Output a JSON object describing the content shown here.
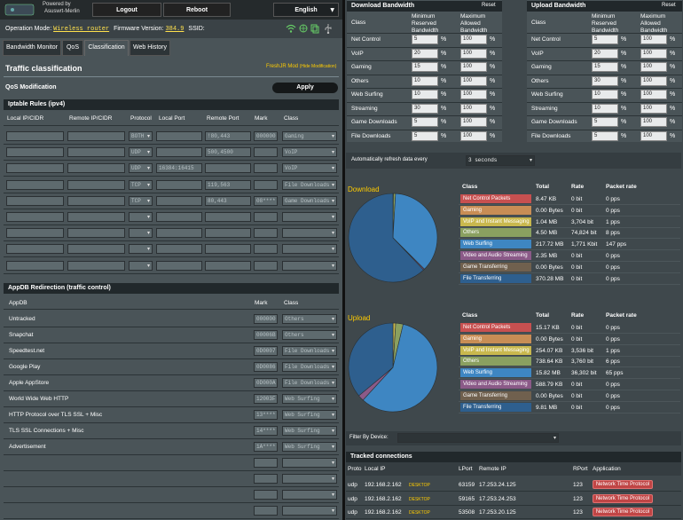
{
  "topbar": {
    "powered_by": "Powered by",
    "brand": "Asuswrt-Merlin",
    "logout": "Logout",
    "reboot": "Reboot",
    "language": "English"
  },
  "status": {
    "mode_label": "Operation Mode:",
    "mode_value": "Wireless router",
    "fw_label": "Firmware Version:",
    "fw_value": "384.9",
    "ssid_label": "SSID:"
  },
  "tabs": [
    "Bandwidth Monitor",
    "QoS",
    "Classification",
    "Web History"
  ],
  "page": {
    "title": "Traffic classification",
    "mod": "FreshJR Mod",
    "mod_hide": "(Hide Modification)",
    "qos_mod": "QoS Modification",
    "apply": "Apply"
  },
  "iptable": {
    "title": "Iptable Rules (ipv4)",
    "headers": [
      "Local IP/CIDR",
      "Remote IP/CIDR",
      "Protocol",
      "Local Port",
      "Remote Port",
      "Mark",
      "Class"
    ],
    "rows": [
      {
        "proto": "BOTH",
        "lport": "",
        "rport": "!80,443",
        "mark": "000000",
        "cls": "Gaming"
      },
      {
        "proto": "UDP",
        "lport": "",
        "rport": "500,4500",
        "mark": "",
        "cls": "VoIP"
      },
      {
        "proto": "UDP",
        "lport": "16384:16415",
        "rport": "",
        "mark": "",
        "cls": "VoIP"
      },
      {
        "proto": "TCP",
        "lport": "",
        "rport": "119,563",
        "mark": "",
        "cls": "File Downloads"
      },
      {
        "proto": "TCP",
        "lport": "",
        "rport": "80,443",
        "mark": "08****",
        "cls": "Game Downloads"
      },
      {
        "proto": "",
        "lport": "",
        "rport": "",
        "mark": "",
        "cls": ""
      },
      {
        "proto": "",
        "lport": "",
        "rport": "",
        "mark": "",
        "cls": ""
      },
      {
        "proto": "",
        "lport": "",
        "rport": "",
        "mark": "",
        "cls": ""
      },
      {
        "proto": "",
        "lport": "",
        "rport": "",
        "mark": "",
        "cls": ""
      }
    ]
  },
  "appdb": {
    "title": "AppDB Redirection (traffic control)",
    "headers": [
      "AppDB",
      "Mark",
      "Class"
    ],
    "rows": [
      {
        "name": "Untracked",
        "mark": "000000",
        "cls": "Others"
      },
      {
        "name": "Snapchat",
        "mark": "00006B",
        "cls": "Others"
      },
      {
        "name": "Speedtest.net",
        "mark": "0D0007",
        "cls": "File Downloads"
      },
      {
        "name": "Google Play",
        "mark": "0D0086",
        "cls": "File Downloads"
      },
      {
        "name": "Apple AppStore",
        "mark": "0D000A",
        "cls": "File Downloads"
      },
      {
        "name": "World Wide Web HTTP",
        "mark": "12003F",
        "cls": "Web Surfing"
      },
      {
        "name": "HTTP Protocol over TLS SSL + Misc",
        "mark": "13****",
        "cls": "Web Surfing"
      },
      {
        "name": "TLS SSL Connections + Misc",
        "mark": "14****",
        "cls": "Web Surfing"
      },
      {
        "name": "Advertisement",
        "mark": "1A****",
        "cls": "Web Surfing"
      },
      {
        "name": "",
        "mark": "",
        "cls": ""
      },
      {
        "name": "",
        "mark": "",
        "cls": ""
      },
      {
        "name": "",
        "mark": "",
        "cls": ""
      },
      {
        "name": "",
        "mark": "",
        "cls": ""
      }
    ]
  },
  "download_bw": {
    "title": "Download Bandwidth",
    "reset": "Reset",
    "col_class": "Class",
    "col_min": "Minimum Reserved Bandwidth",
    "col_max": "Maximum Allowed Bandwidth",
    "rows": [
      {
        "cls": "Net Control",
        "min": "5",
        "max": "100"
      },
      {
        "cls": "VoIP",
        "min": "20",
        "max": "100"
      },
      {
        "cls": "Gaming",
        "min": "15",
        "max": "100"
      },
      {
        "cls": "Others",
        "min": "10",
        "max": "100"
      },
      {
        "cls": "Web Surfing",
        "min": "10",
        "max": "100"
      },
      {
        "cls": "Streaming",
        "min": "30",
        "max": "100"
      },
      {
        "cls": "Game Downloads",
        "min": "5",
        "max": "100"
      },
      {
        "cls": "File Downloads",
        "min": "5",
        "max": "100"
      }
    ]
  },
  "upload_bw": {
    "title": "Upload Bandwidth",
    "reset": "Reset",
    "col_class": "Class",
    "col_min": "Minimum Reserved Bandwidth",
    "col_max": "Maximum Allowed Bandwidth",
    "rows": [
      {
        "cls": "Net Control",
        "min": "5",
        "max": "100"
      },
      {
        "cls": "VoIP",
        "min": "20",
        "max": "100"
      },
      {
        "cls": "Gaming",
        "min": "15",
        "max": "100"
      },
      {
        "cls": "Others",
        "min": "30",
        "max": "100"
      },
      {
        "cls": "Web Surfing",
        "min": "10",
        "max": "100"
      },
      {
        "cls": "Streaming",
        "min": "10",
        "max": "100"
      },
      {
        "cls": "Game Downloads",
        "min": "5",
        "max": "100"
      },
      {
        "cls": "File Downloads",
        "min": "5",
        "max": "100"
      }
    ]
  },
  "refresh": {
    "label": "Automatically refresh data every",
    "value": "3 seconds"
  },
  "stats_headers": {
    "cls": "Class",
    "total": "Total",
    "rate": "Rate",
    "packet": "Packet rate"
  },
  "download": {
    "label": "Download",
    "rows": [
      {
        "cls": "Net Control Packets",
        "total": "8.47 KB",
        "rate": "0 bit",
        "packet": "0 pps",
        "color": "#c75050"
      },
      {
        "cls": "Gaming",
        "total": "0.00 Bytes",
        "rate": "0 bit",
        "packet": "0 pps",
        "color": "#c88d55"
      },
      {
        "cls": "VoIP and Instant Messaging",
        "total": "1.04 MB",
        "rate": "3,704 bit",
        "packet": "1 pps",
        "color": "#c9b84e"
      },
      {
        "cls": "Others",
        "total": "4.50 MB",
        "rate": "74,824 bit",
        "packet": "8 pps",
        "color": "#8aa060"
      },
      {
        "cls": "Web Surfing",
        "total": "217.72 MB",
        "rate": "1,771 Kbit",
        "packet": "147 pps",
        "color": "#3e86c2"
      },
      {
        "cls": "Video and Audio Streaming",
        "total": "2.35 MB",
        "rate": "0 bit",
        "packet": "0 pps",
        "color": "#8b5a88"
      },
      {
        "cls": "Game Transferring",
        "total": "0.00 Bytes",
        "rate": "0 bit",
        "packet": "0 pps",
        "color": "#70604e"
      },
      {
        "cls": "File Transferring",
        "total": "370.28 MB",
        "rate": "0 bit",
        "packet": "0 pps",
        "color": "#2e5f8e"
      }
    ]
  },
  "upload": {
    "label": "Upload",
    "rows": [
      {
        "cls": "Net Control Packets",
        "total": "15.17 KB",
        "rate": "0 bit",
        "packet": "0 pps",
        "color": "#c75050"
      },
      {
        "cls": "Gaming",
        "total": "0.00 Bytes",
        "rate": "0 bit",
        "packet": "0 pps",
        "color": "#c88d55"
      },
      {
        "cls": "VoIP and Instant Messaging",
        "total": "254.07 KB",
        "rate": "3,536 bit",
        "packet": "1 pps",
        "color": "#c9b84e"
      },
      {
        "cls": "Others",
        "total": "738.64 KB",
        "rate": "3,760 bit",
        "packet": "6 pps",
        "color": "#8aa060"
      },
      {
        "cls": "Web Surfing",
        "total": "15.82 MB",
        "rate": "36,302 bit",
        "packet": "65 pps",
        "color": "#3e86c2"
      },
      {
        "cls": "Video and Audio Streaming",
        "total": "588.79 KB",
        "rate": "0 bit",
        "packet": "0 pps",
        "color": "#8b5a88"
      },
      {
        "cls": "Game Transferring",
        "total": "0.00 Bytes",
        "rate": "0 bit",
        "packet": "0 pps",
        "color": "#70604e"
      },
      {
        "cls": "File Transferring",
        "total": "9.81 MB",
        "rate": "0 bit",
        "packet": "0 pps",
        "color": "#2e5f8e"
      }
    ]
  },
  "chart_data": [
    {
      "type": "pie",
      "categories": [
        "Net Control Packets",
        "Gaming",
        "VoIP and Instant Messaging",
        "Others",
        "Web Surfing",
        "Video and Audio Streaming",
        "Game Transferring",
        "File Transferring"
      ],
      "values": [
        0.0085,
        0,
        1.04,
        4.5,
        217.72,
        2.35,
        0,
        370.28
      ],
      "colors": [
        "#c75050",
        "#c88d55",
        "#c9b84e",
        "#8aa060",
        "#3e86c2",
        "#8b5a88",
        "#70604e",
        "#2e5f8e"
      ]
    },
    {
      "type": "pie",
      "categories": [
        "Net Control Packets",
        "Gaming",
        "VoIP and Instant Messaging",
        "Others",
        "Web Surfing",
        "Video and Audio Streaming",
        "Game Transferring",
        "File Transferring"
      ],
      "values": [
        0.0148,
        0,
        0.254,
        0.739,
        15.82,
        0.589,
        0,
        9.81
      ],
      "colors": [
        "#c75050",
        "#c88d55",
        "#c9b84e",
        "#8aa060",
        "#3e86c2",
        "#8b5a88",
        "#70604e",
        "#2e5f8e"
      ]
    }
  ],
  "filter": {
    "label": "Filter By Device:",
    "value": ""
  },
  "tracked": {
    "title": "Tracked connections",
    "headers": [
      "Proto",
      "Local IP",
      "LPort",
      "Remote IP",
      "RPort",
      "Application"
    ],
    "rows": [
      {
        "proto": "udp",
        "lip": "192.168.2.162",
        "dev": "DESKTOP",
        "lport": "63159",
        "rip": "17.253.24.125",
        "rport": "123",
        "app": "Network Time Protocol"
      },
      {
        "proto": "udp",
        "lip": "192.168.2.162",
        "dev": "DESKTOP",
        "lport": "59165",
        "rip": "17.253.24.253",
        "rport": "123",
        "app": "Network Time Protocol"
      },
      {
        "proto": "udp",
        "lip": "192.168.2.162",
        "dev": "DESKTOP",
        "lport": "53508",
        "rip": "17.253.20.125",
        "rport": "123",
        "app": "Network Time Protocol"
      }
    ]
  }
}
